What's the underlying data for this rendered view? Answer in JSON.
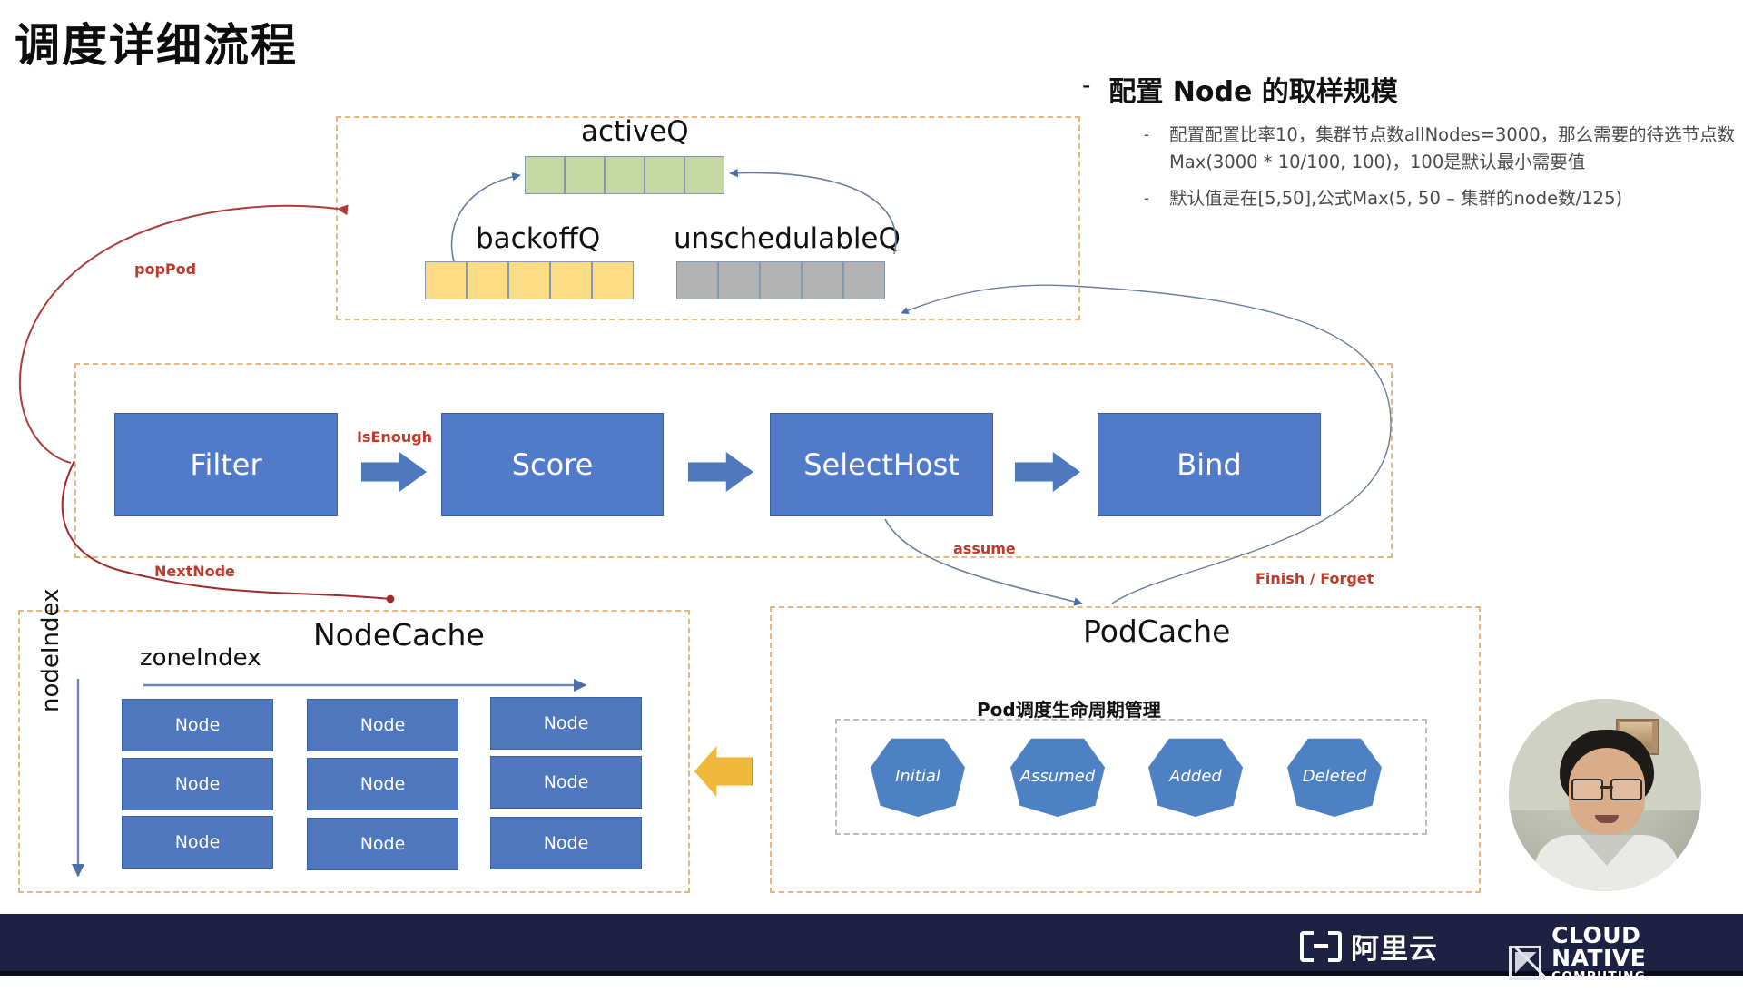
{
  "slide": {
    "title": "调度详细流程"
  },
  "notes": {
    "heading": "配置 Node 的取样规模",
    "dash": "-",
    "bullets": [
      "配置配置比率10，集群节点数allNodes=3000，那么需要的待选节点数 Max(3000 * 10/100, 100)，100是默认最小需要值",
      "默认值是在[5,50],公式Max(5, 50 – 集群的node数/125)"
    ]
  },
  "queues": {
    "active": {
      "label": "activeQ",
      "cells": 5,
      "color": "#c5d8a4"
    },
    "backoff": {
      "label": "backoffQ",
      "cells": 5,
      "color": "#fbdb84"
    },
    "unschedulable": {
      "label": "unschedulableQ",
      "cells": 5,
      "color": "#b2b2b2"
    }
  },
  "pipeline": {
    "stages": [
      {
        "label": "Filter"
      },
      {
        "label": "Score"
      },
      {
        "label": "SelectHost"
      },
      {
        "label": "Bind"
      }
    ],
    "arrow_label": "IsEnough"
  },
  "annotations": {
    "popPod": "popPod",
    "nextNode": "NextNode",
    "assume": "assume",
    "finishForget": "Finish / Forget",
    "color": "#c0392b"
  },
  "nodeCache": {
    "title": "NodeCache",
    "zoneIndex": "zoneIndex",
    "nodeIndex": "nodeIndex",
    "columns": [
      [
        "Node",
        "Node",
        "Node"
      ],
      [
        "Node",
        "Node",
        "Node"
      ],
      [
        "Node",
        "Node",
        "Node"
      ]
    ]
  },
  "podCache": {
    "title": "PodCache",
    "lifecycle_title": "Pod调度生命周期管理",
    "states": [
      "Initial",
      "Assumed",
      "Added",
      "Deleted"
    ]
  },
  "footer": {
    "alibaba": "阿里云",
    "cncf_line1": "CLOUD NATIVE",
    "cncf_line2": "COMPUTING FOUNDATION",
    "background": "#1e2142"
  }
}
